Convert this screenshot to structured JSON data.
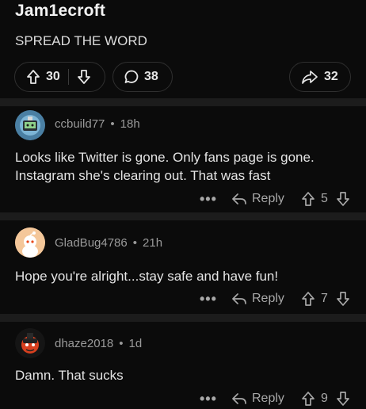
{
  "post": {
    "author": "Jam1ecroft",
    "body": "SPREAD THE WORD",
    "upvotes": "30",
    "comments": "38",
    "shares": "32"
  },
  "comments": [
    {
      "username": "ccbuild77",
      "age": "18h",
      "text": "Looks like Twitter is gone. Only fans page is gone. Instagram she's clearing out. That was fast",
      "reply_label": "Reply",
      "score": "5",
      "more": "•••"
    },
    {
      "username": "GladBug4786",
      "age": "21h",
      "text": "Hope you're alright...stay safe and have fun!",
      "reply_label": "Reply",
      "score": "7",
      "more": "•••"
    },
    {
      "username": "dhaze2018",
      "age": "1d",
      "text": "Damn. That sucks",
      "reply_label": "Reply",
      "score": "9",
      "more": "•••"
    }
  ],
  "meta_separator": "•",
  "colors": {
    "background": "#0b0b0b",
    "divider": "#1c1c1c",
    "muted": "#9a9a9a",
    "text": "#e4e4e4"
  }
}
